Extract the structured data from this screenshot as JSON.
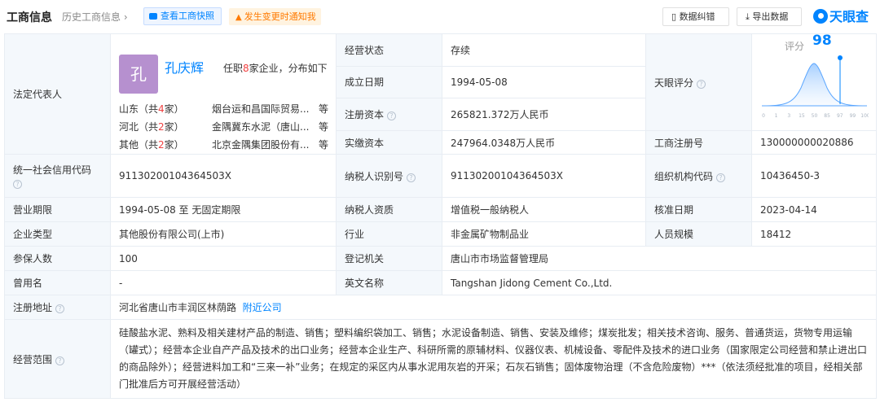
{
  "header": {
    "title": "工商信息",
    "history": "历史工商信息",
    "history_arrow": "›",
    "snapshot_btn": "查看工商快照",
    "notify_btn": "发生变更时通知我",
    "error_btn": "数据纠错",
    "export_btn": "导出数据",
    "logo": "天眼查"
  },
  "labels": {
    "legal_rep": "法定代表人",
    "status": "经营状态",
    "founded": "成立日期",
    "reg_capital": "注册资本",
    "paid_capital": "实缴资本",
    "score": "天眼评分",
    "reg_no": "工商注册号",
    "credit_code": "统一社会信用代码",
    "taxpayer_id": "纳税人识别号",
    "org_code": "组织机构代码",
    "term": "营业期限",
    "taxpayer_type": "纳税人资质",
    "approve_date": "核准日期",
    "company_type": "企业类型",
    "industry": "行业",
    "staff": "人员规模",
    "insured": "参保人数",
    "authority": "登记机关",
    "former_name": "曾用名",
    "english_name": "英文名称",
    "address": "注册地址",
    "scope": "经营范围"
  },
  "legal_rep": {
    "avatar": "孔",
    "name": "孔庆辉",
    "jobs_prefix": "任职",
    "jobs_count": "8",
    "jobs_suffix": "家企业，分布如下",
    "regions": [
      {
        "region": "山东（共",
        "count": "4",
        "unit": "家）",
        "company": "烟台运和昌国际贸易...",
        "etc": "等"
      },
      {
        "region": "河北（共",
        "count": "2",
        "unit": "家）",
        "company": "金隅冀东水泥（唐山...",
        "etc": "等"
      },
      {
        "region": "其他（共",
        "count": "2",
        "unit": "家）",
        "company": "北京金隅集团股份有...",
        "etc": "等"
      }
    ]
  },
  "values": {
    "status": "存续",
    "founded": "1994-05-08",
    "reg_capital": "265821.372万人民币",
    "paid_capital": "247964.0348万人民币",
    "reg_no": "130000000020886",
    "credit_code": "91130200104364503X",
    "taxpayer_id": "91130200104364503X",
    "org_code": "10436450-3",
    "term": "1994-05-08 至 无固定期限",
    "taxpayer_type": "增值税一般纳税人",
    "approve_date": "2023-04-14",
    "company_type": "其他股份有限公司(上市)",
    "industry": "非金属矿物制品业",
    "staff": "18412",
    "insured": "100",
    "authority": "唐山市市场监督管理局",
    "former_name": "-",
    "english_name": "Tangshan Jidong Cement Co.,Ltd.",
    "address": "河北省唐山市丰润区林荫路",
    "nearby": "附近公司",
    "scope": "硅酸盐水泥、熟料及相关建材产品的制造、销售；塑料编织袋加工、销售；水泥设备制造、销售、安装及维修；煤炭批发；相关技术咨询、服务、普通货运，货物专用运输（罐式）；经营本企业自产产品及技术的出口业务；经营本企业生产、科研所需的原辅材料、仪器仪表、机械设备、零配件及技术的进口业务（国家限定公司经营和禁止进出口的商品除外）；经营进料加工和“三来一补”业务；在规定的采区内从事水泥用灰岩的开采；石灰石销售；固体废物治理（不含危险废物）***（依法须经批准的项目，经相关部门批准后方可开展经营活动）"
  },
  "score": {
    "label": "评分",
    "value": "98",
    "value_num": 98,
    "axis": [
      "0",
      "1",
      "3",
      "15",
      "50",
      "85",
      "97",
      "99",
      "100"
    ]
  },
  "colors": {
    "accent": "#0084ff",
    "highlight": "#f04040",
    "label_bg": "#f4f8fc"
  }
}
